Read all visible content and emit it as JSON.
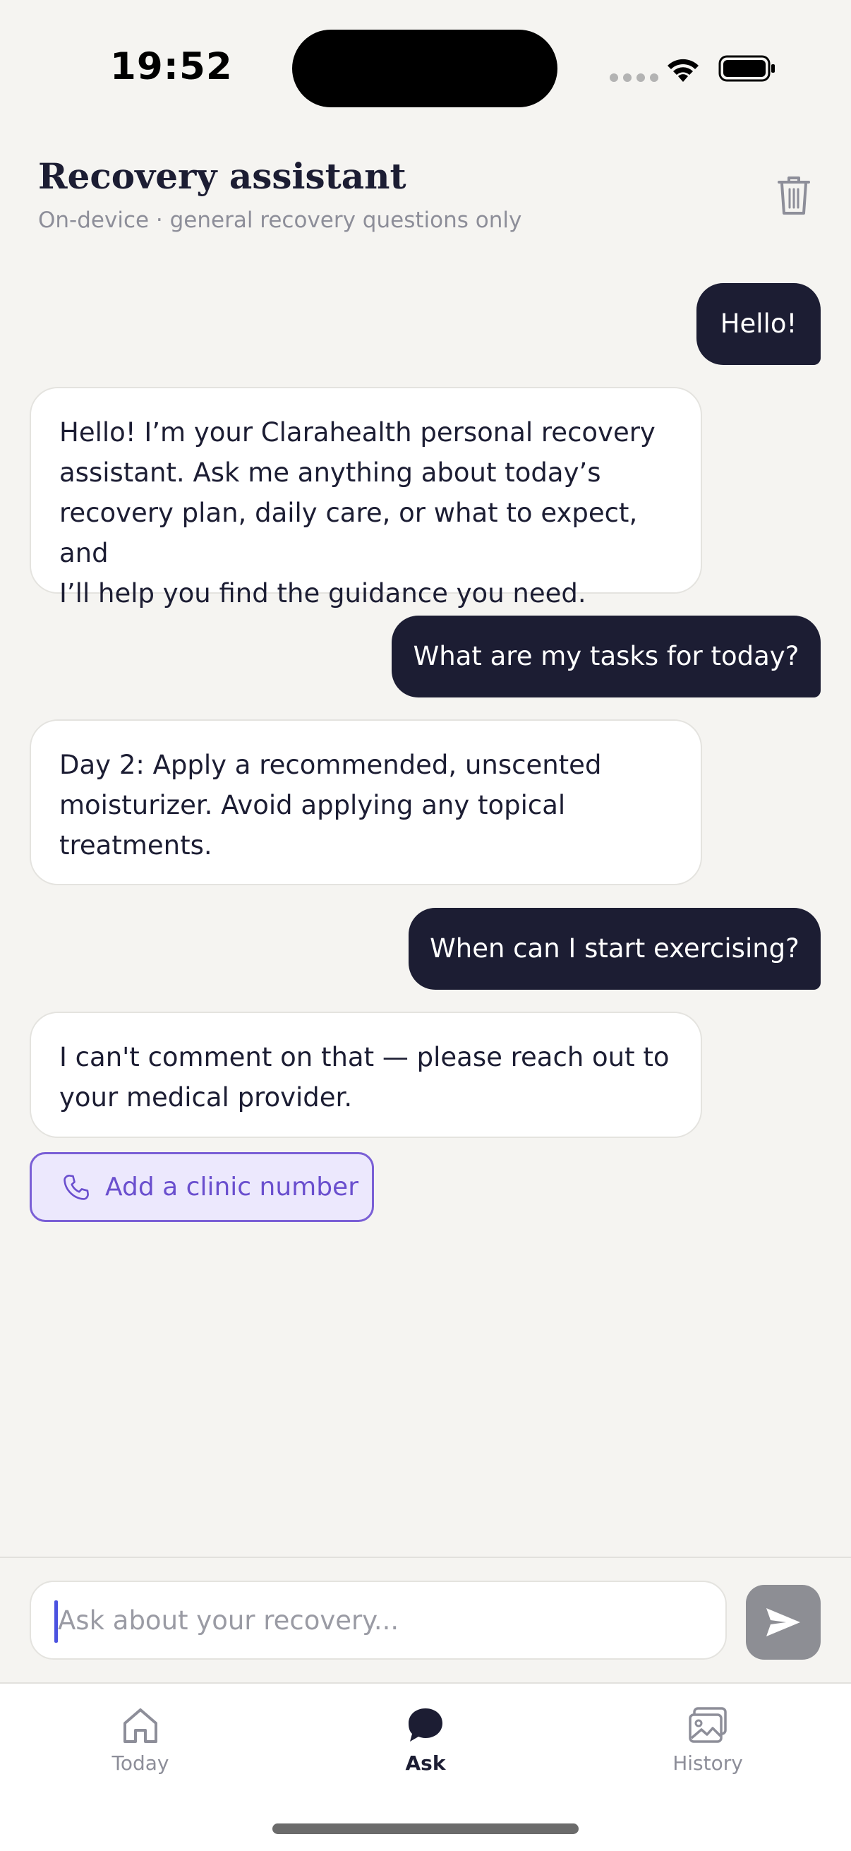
{
  "status_bar": {
    "time": "19:52"
  },
  "header": {
    "title": "Recovery assistant",
    "subtitle": "On-device · general recovery questions only"
  },
  "messages": [
    {
      "role": "user",
      "lines": [
        "Hello!"
      ]
    },
    {
      "role": "assistant",
      "lines": [
        "Hello! I’m your Clarahealth personal recovery",
        "assistant. Ask me anything about today’s",
        "recovery plan, daily care, or what to expect, and",
        "I’ll help you find the guidance you need."
      ]
    },
    {
      "role": "user",
      "lines": [
        "What are my tasks for today?"
      ]
    },
    {
      "role": "assistant",
      "lines": [
        "Day 2: Apply a recommended, unscented",
        "moisturizer. Avoid applying any topical",
        "treatments."
      ]
    },
    {
      "role": "user",
      "lines": [
        "When can I start exercising?"
      ]
    },
    {
      "role": "assistant",
      "lines": [
        "I can't comment on that — please reach out to",
        "your medical provider."
      ]
    }
  ],
  "action": {
    "label": "Add a clinic number",
    "icon": "phone-icon"
  },
  "composer": {
    "placeholder": "Ask about your recovery...",
    "send_icon": "send-icon"
  },
  "tabs": [
    {
      "label": "Today",
      "icon": "home-icon",
      "active": false
    },
    {
      "label": "Ask",
      "icon": "chat-bubble-icon",
      "active": true
    },
    {
      "label": "History",
      "icon": "gallery-icon",
      "active": false
    }
  ],
  "colors": {
    "background": "#f5f4f1",
    "user_bubble": "#1c1d33",
    "accent": "#6a4fce",
    "accent_bg": "#ece8fd",
    "muted": "#8d8e99"
  }
}
